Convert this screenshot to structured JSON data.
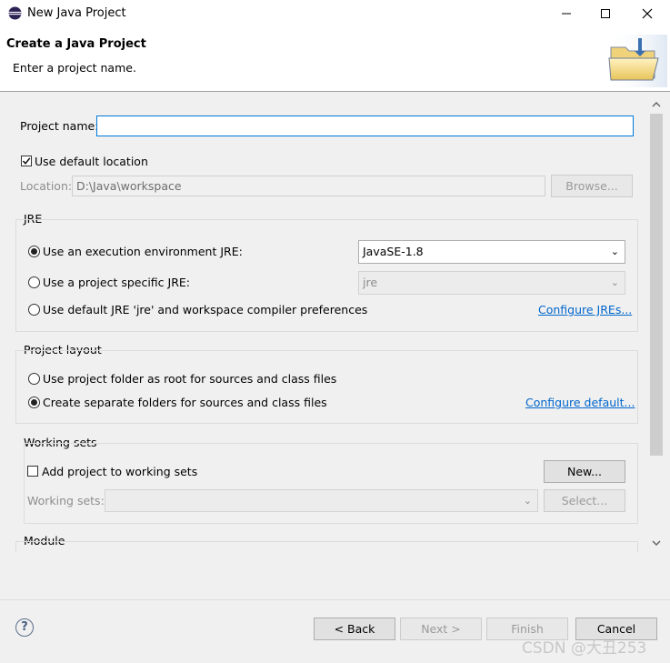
{
  "window": {
    "title": "New Java Project",
    "minimize": "—",
    "maximize": "☐",
    "close": "✕"
  },
  "header": {
    "title": "Create a Java Project",
    "subtitle": "Enter a project name."
  },
  "project": {
    "name_label": "Project name:",
    "name_value": ""
  },
  "location": {
    "use_default_label": "Use default location",
    "use_default_checked": true,
    "label": "Location:",
    "value": "D:\\Java\\workspace",
    "browse": "Browse..."
  },
  "jre": {
    "group_label": "JRE",
    "opt1": "Use an execution environment JRE:",
    "opt1_value": "JavaSE-1.8",
    "opt2": "Use a project specific JRE:",
    "opt2_value": "jre",
    "opt3": "Use default JRE 'jre' and workspace compiler preferences",
    "configure_link": "Configure JREs...",
    "selected": "opt1"
  },
  "layout": {
    "group_label": "Project layout",
    "opt1": "Use project folder as root for sources and class files",
    "opt2": "Create separate folders for sources and class files",
    "configure_link": "Configure default...",
    "selected": "opt2"
  },
  "working_sets": {
    "group_label": "Working sets",
    "add_label": "Add project to working sets",
    "add_checked": false,
    "new_button": "New...",
    "sets_label": "Working sets:",
    "select_button": "Select..."
  },
  "module": {
    "group_label": "Module"
  },
  "footer": {
    "help": "?",
    "back": "< Back",
    "next": "Next >",
    "finish": "Finish",
    "cancel": "Cancel"
  },
  "watermark": "CSDN @大丑253",
  "colors": {
    "accent": "#0078d7",
    "link": "#0066cc",
    "background": "#f0f0f0"
  }
}
